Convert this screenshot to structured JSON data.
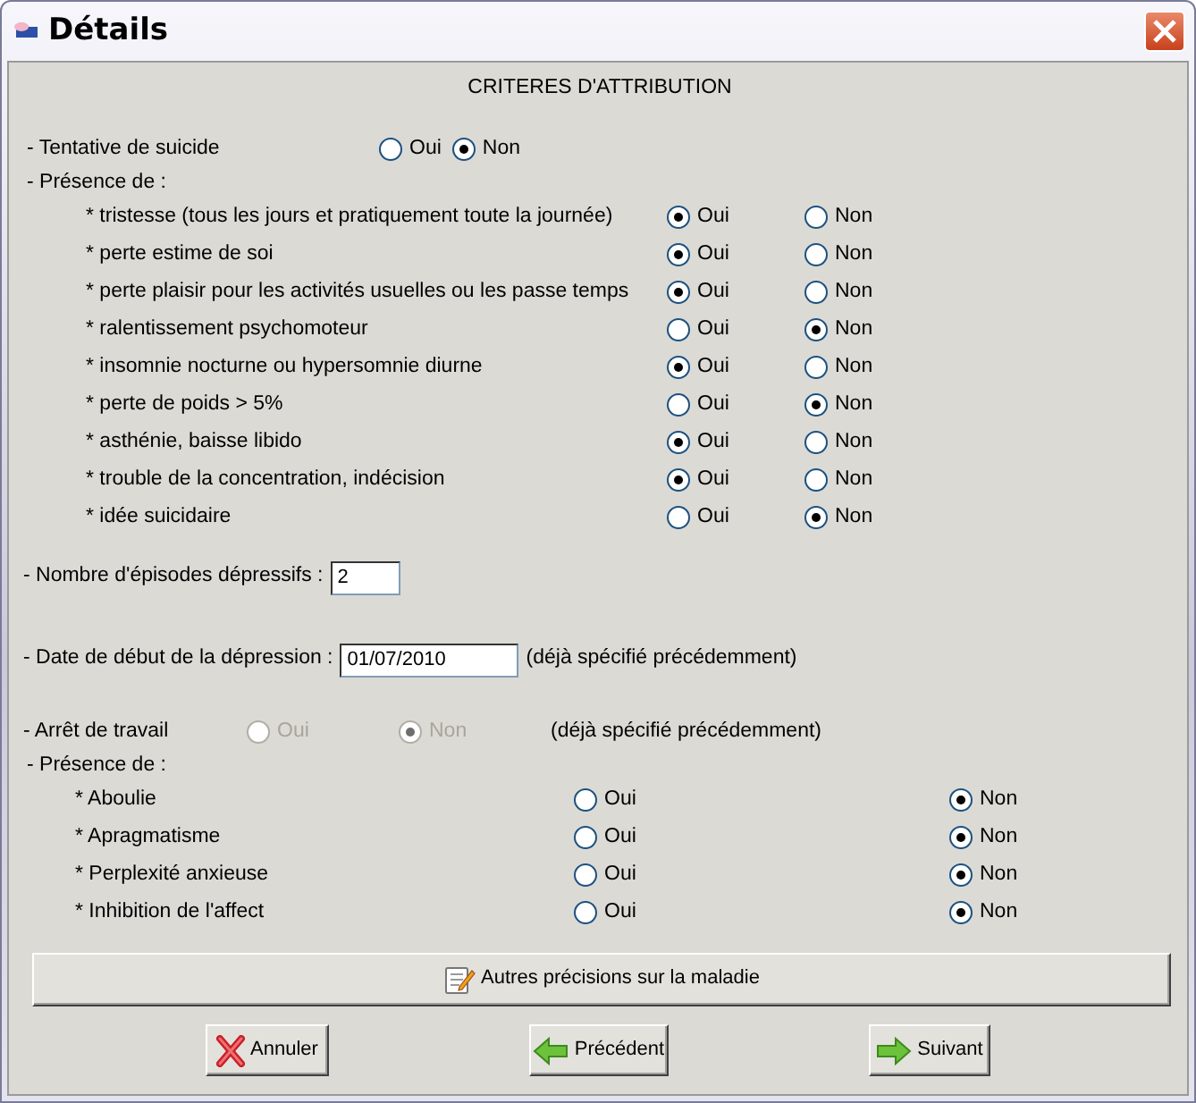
{
  "window": {
    "title": "Détails"
  },
  "heading": "CRITERES D'ATTRIBUTION",
  "suicide": {
    "label": "- Tentative de suicide",
    "options": [
      {
        "label": "Oui",
        "selected": false
      },
      {
        "label": "Non",
        "selected": true
      }
    ]
  },
  "presence_1": {
    "label": "- Présence de :",
    "items": [
      {
        "label": "* tristesse (tous les jours et pratiquement toute la journée)",
        "options": [
          {
            "label": "Oui",
            "selected": true
          },
          {
            "label": "Non",
            "selected": false
          }
        ]
      },
      {
        "label": "* perte estime de soi",
        "options": [
          {
            "label": "Oui",
            "selected": true
          },
          {
            "label": "Non",
            "selected": false
          }
        ]
      },
      {
        "label": "* perte plaisir pour les activités usuelles ou les passe temps",
        "options": [
          {
            "label": "Oui",
            "selected": true
          },
          {
            "label": "Non",
            "selected": false
          }
        ]
      },
      {
        "label": "* ralentissement psychomoteur",
        "options": [
          {
            "label": "Oui",
            "selected": false
          },
          {
            "label": "Non",
            "selected": true
          }
        ]
      },
      {
        "label": "* insomnie nocturne ou hypersomnie diurne",
        "options": [
          {
            "label": "Oui",
            "selected": true
          },
          {
            "label": "Non",
            "selected": false
          }
        ]
      },
      {
        "label": "* perte de poids > 5%",
        "options": [
          {
            "label": "Oui",
            "selected": false
          },
          {
            "label": "Non",
            "selected": true
          }
        ]
      },
      {
        "label": "* asthénie, baisse libido",
        "options": [
          {
            "label": "Oui",
            "selected": true
          },
          {
            "label": "Non",
            "selected": false
          }
        ]
      },
      {
        "label": "* trouble de la concentration, indécision",
        "options": [
          {
            "label": "Oui",
            "selected": true
          },
          {
            "label": "Non",
            "selected": false
          }
        ]
      },
      {
        "label": "* idée suicidaire",
        "options": [
          {
            "label": "Oui",
            "selected": false
          },
          {
            "label": "Non",
            "selected": true
          }
        ]
      }
    ]
  },
  "episodes": {
    "label": "- Nombre d'épisodes dépressifs :",
    "value": "2"
  },
  "start_date": {
    "label": "- Date de début de la dépression :",
    "value": "01/07/2010",
    "note": "(déjà spécifié précédemment)"
  },
  "work_stop": {
    "label": "- Arrêt de travail",
    "disabled": true,
    "options": [
      {
        "label": "Oui",
        "selected": false
      },
      {
        "label": "Non",
        "selected": true
      }
    ],
    "note": "(déjà spécifié précédemment)"
  },
  "presence_2": {
    "label": "- Présence de :",
    "items": [
      {
        "label": "* Aboulie",
        "options": [
          {
            "label": "Oui",
            "selected": false
          },
          {
            "label": "Non",
            "selected": true
          }
        ]
      },
      {
        "label": "* Apragmatisme",
        "options": [
          {
            "label": "Oui",
            "selected": false
          },
          {
            "label": "Non",
            "selected": true
          }
        ]
      },
      {
        "label": "* Perplexité anxieuse",
        "options": [
          {
            "label": "Oui",
            "selected": false
          },
          {
            "label": "Non",
            "selected": true
          }
        ]
      },
      {
        "label": "* Inhibition de l'affect",
        "options": [
          {
            "label": "Oui",
            "selected": false
          },
          {
            "label": "Non",
            "selected": true
          }
        ]
      }
    ]
  },
  "details_button": "Autres précisions sur la maladie",
  "buttons": [
    {
      "label": "Annuler",
      "kind": "cancel"
    },
    {
      "label": "Précédent",
      "kind": "back"
    },
    {
      "label": "Suivant",
      "kind": "next"
    }
  ]
}
